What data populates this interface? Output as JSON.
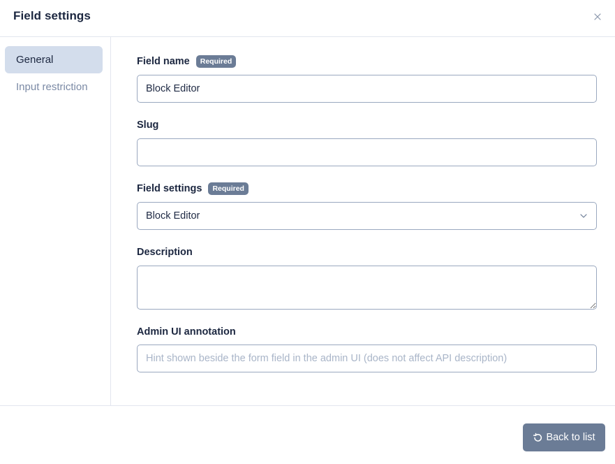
{
  "dialog": {
    "title": "Field settings",
    "close_icon": "close-icon"
  },
  "sidebar": {
    "items": [
      {
        "label": "General",
        "active": true
      },
      {
        "label": "Input restriction",
        "active": false
      }
    ]
  },
  "form": {
    "field_name": {
      "label": "Field name",
      "badge": "Required",
      "value": "Block Editor",
      "placeholder": ""
    },
    "slug": {
      "label": "Slug",
      "value": "",
      "placeholder": ""
    },
    "field_settings": {
      "label": "Field settings",
      "badge": "Required",
      "selected": "Block Editor",
      "icon": "chevron-down-icon"
    },
    "description": {
      "label": "Description",
      "value": ""
    },
    "admin_ui_annotation": {
      "label": "Admin UI annotation",
      "value": "",
      "placeholder": "Hint shown beside the form field in the admin UI (does not affect API description)"
    }
  },
  "footer": {
    "back_label": "Back to list",
    "back_icon": "undo-icon"
  },
  "colors": {
    "accent": "#6b7c96",
    "active_nav": "#d3ddec",
    "border": "#9aa8bf"
  }
}
